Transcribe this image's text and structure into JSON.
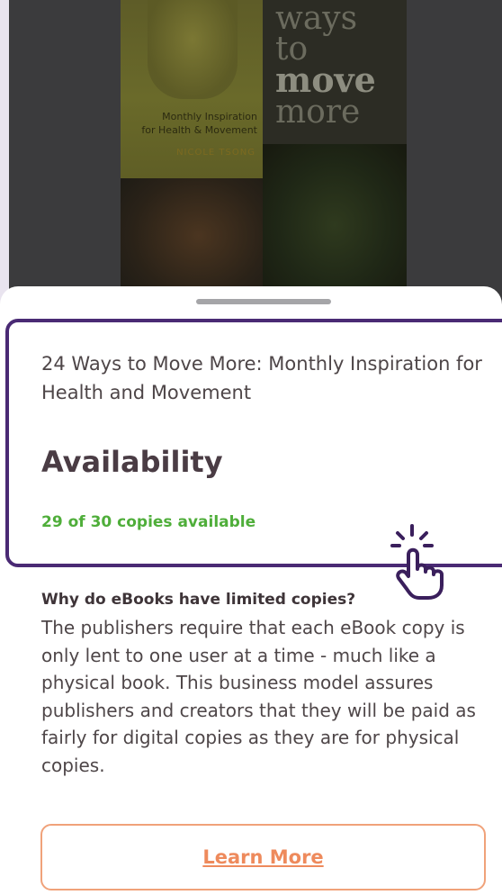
{
  "cover": {
    "title_lines": [
      "ways",
      "to",
      "move",
      "more"
    ],
    "subtitle_lines": [
      "Monthly Inspiration",
      "for Health & Movement"
    ],
    "author": "NICOLE TSONG"
  },
  "sheet": {
    "book_title": "24 Ways to Move More: Monthly Inspiration for Health and Movement",
    "availability_heading": "Availability",
    "copies_text": "29 of 30 copies available",
    "why_heading": "Why do eBooks have limited copies?",
    "why_body": "The publishers require that each eBook copy is only lent to one user at a time - much like a physical book. This business model assures publishers and creators that they will be paid as fairly for digital copies as they are for physical copies.",
    "learn_more_label": "Learn More"
  },
  "colors": {
    "highlight": "#4a2a74",
    "available_green": "#4fae3a",
    "accent_orange": "#ee8a5c"
  },
  "icons": {
    "pointer": "tap-hand-icon"
  }
}
